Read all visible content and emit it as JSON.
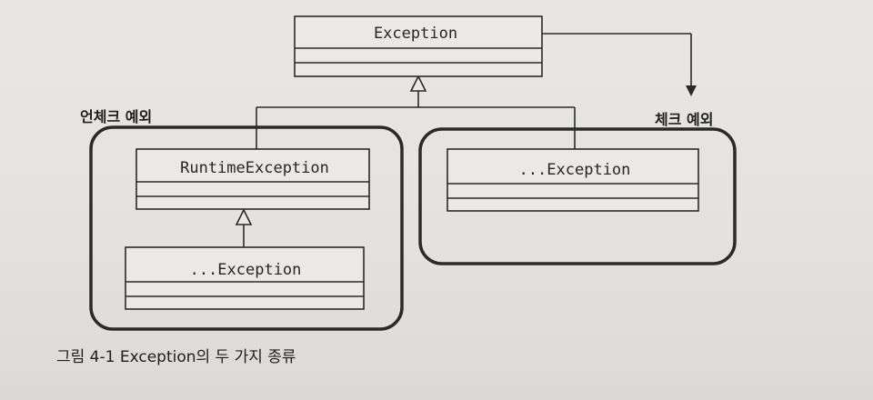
{
  "diagram": {
    "root_class": "Exception",
    "unchecked_group_label": "언체크 예외",
    "checked_group_label": "체크 예외",
    "runtime_class": "RuntimeException",
    "runtime_sub_class": "...Exception",
    "checked_sub_class": "...Exception"
  },
  "caption": "그림 4-1 Exception의 두 가지 종류",
  "colors": {
    "line": "#2a2a2a",
    "box_fill": "#ebe9e5",
    "background": "#e6e4e0"
  }
}
